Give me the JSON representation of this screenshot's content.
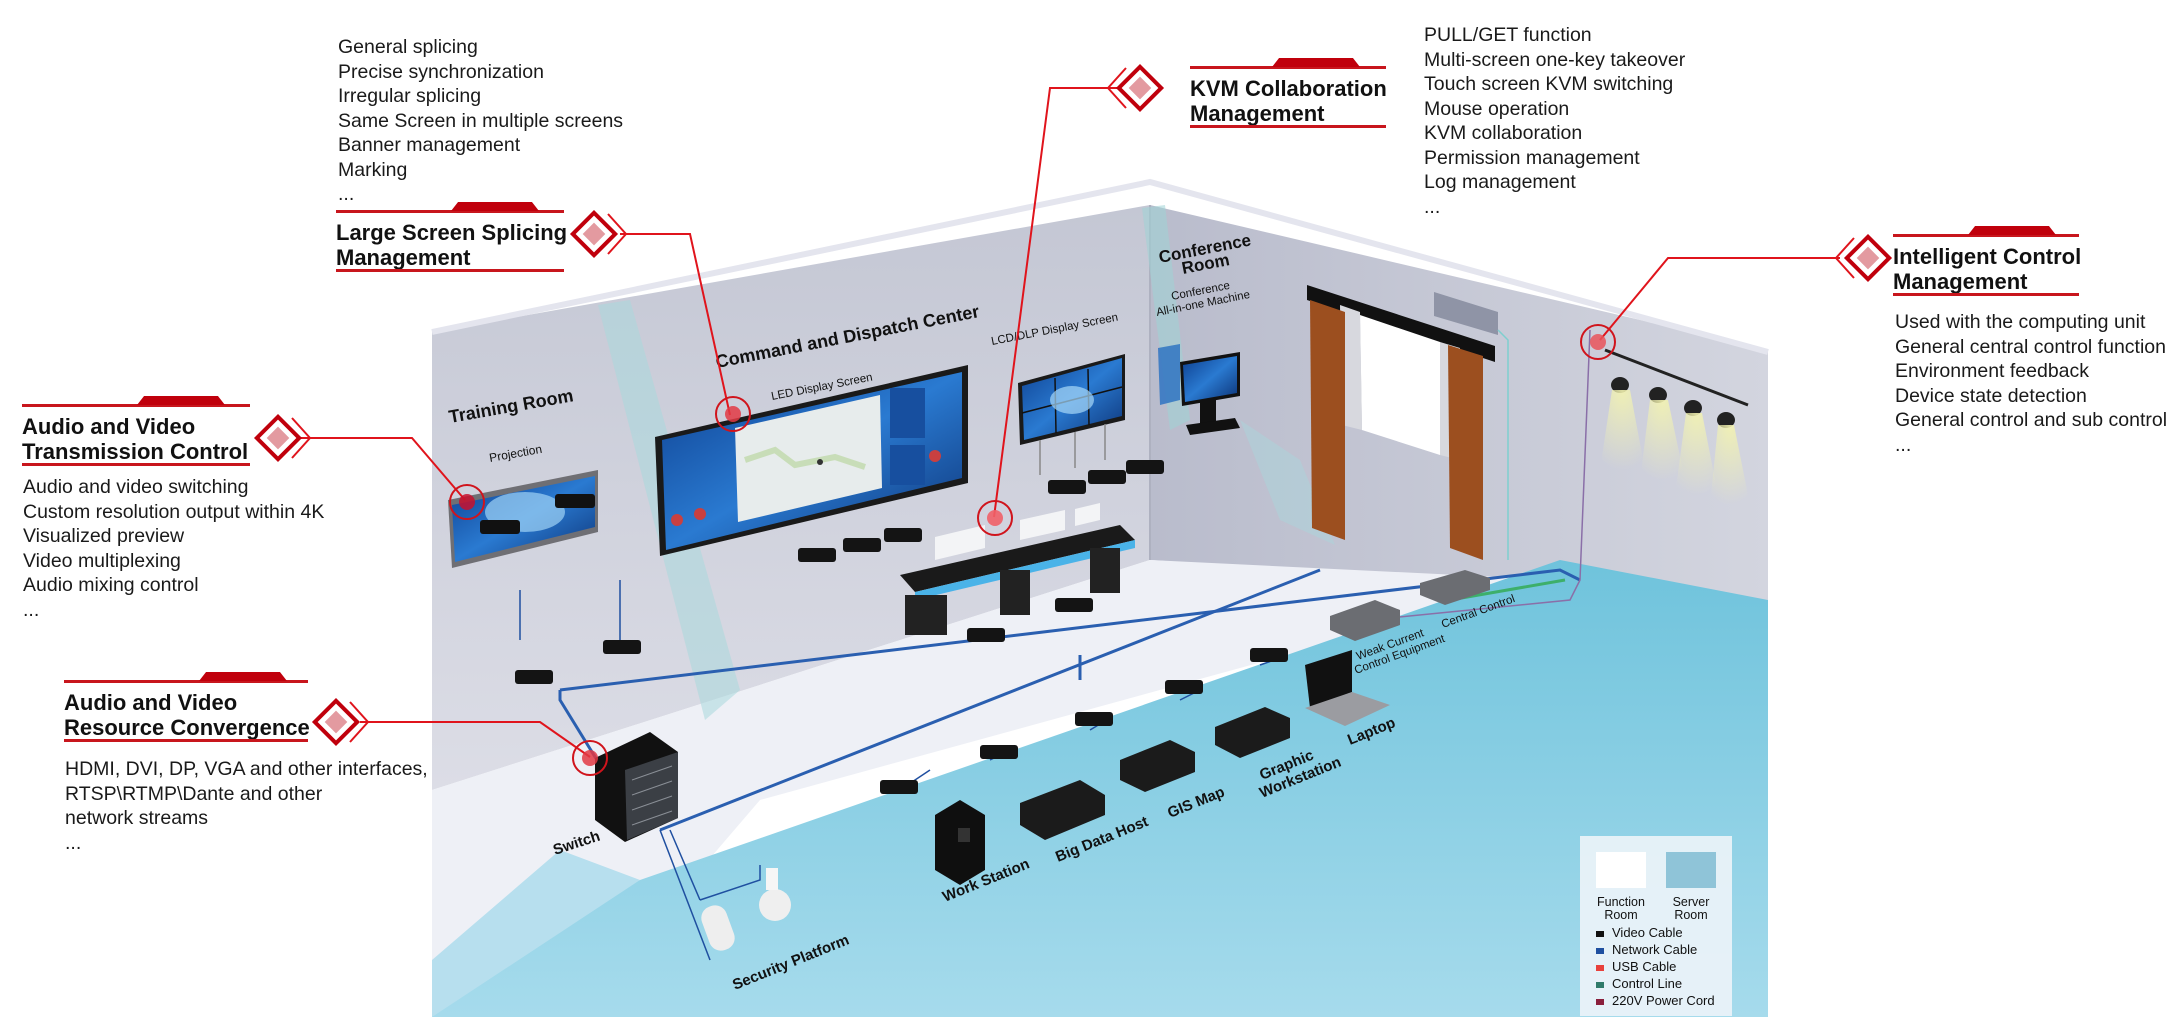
{
  "colors": {
    "accent_red": "#d71920",
    "dark_red": "#b3000b",
    "marker_fill": "#e8838a",
    "wall": "#c9ccd8",
    "floor_function": "#eef0f6",
    "floor_server": "#8ed0e6"
  },
  "modules": [
    {
      "id": "large-screen",
      "title": "Large Screen Splicing\nManagement",
      "title_lines": [
        "Large Screen Splicing",
        "Management"
      ],
      "features": [
        "General splicing",
        "Precise synchronization",
        "Irregular splicing",
        "Same Screen in multiple screens",
        "Banner management",
        "Marking",
        "..."
      ]
    },
    {
      "id": "kvm",
      "title_lines": [
        "KVM Collaboration",
        "Management"
      ],
      "features": [
        "PULL/GET function",
        "Multi-screen one-key takeover",
        "Touch screen KVM switching",
        "Mouse operation",
        "KVM collaboration",
        "Permission management",
        "Log management",
        "..."
      ]
    },
    {
      "id": "intelligent-control",
      "title_lines": [
        "Intelligent Control",
        "Management"
      ],
      "features": [
        "Used with the computing unit",
        "General central control function",
        "Environment feedback",
        "Device state detection",
        "General control and sub control",
        "..."
      ]
    },
    {
      "id": "av-transmission",
      "title_lines": [
        "Audio and Video",
        "Transmission Control"
      ],
      "features": [
        "Audio and video switching",
        "Custom resolution output within 4K",
        "Visualized preview",
        "Video multiplexing",
        "Audio mixing control",
        "..."
      ]
    },
    {
      "id": "av-resource",
      "title_lines": [
        "Audio and Video",
        "Resource Convergence"
      ],
      "features": [
        "HDMI, DVI, DP, VGA and other interfaces,",
        "RTSP\\RTMP\\Dante and other",
        "network streams",
        "..."
      ]
    }
  ],
  "scene": {
    "rooms": {
      "training": "Training Room",
      "projection": "Projection",
      "command": "Command and Dispatch Center",
      "led": "LED Display Screen",
      "lcd": "LCD/DLP Display Screen",
      "conference_1": "Conference",
      "conference_2": "Room",
      "conf_machine_1": "Conference",
      "conf_machine_2": "All-in-one Machine"
    },
    "devices": {
      "switch": "Switch",
      "security": "Security Platform",
      "workstation": "Work Station",
      "bigdata": "Big Data Host",
      "gis": "GIS Map",
      "graphic_1": "Graphic",
      "graphic_2": "Workstation",
      "laptop": "Laptop",
      "weak_1": "Weak Current",
      "weak_2": "Control Equipment",
      "central": "Central Control"
    }
  },
  "legend": {
    "rooms": [
      {
        "label_1": "Function",
        "label_2": "Room",
        "color": "#ffffff"
      },
      {
        "label_1": "Server",
        "label_2": "Room",
        "color": "#8fc4d8"
      }
    ],
    "cables": [
      {
        "label": "Video Cable",
        "color": "#111111"
      },
      {
        "label": "Network Cable",
        "color": "#1f4fa0"
      },
      {
        "label": "USB Cable",
        "color": "#e8413c"
      },
      {
        "label": "Control Line",
        "color": "#2f7a6a"
      },
      {
        "label": "220V Power Cord",
        "color": "#8a1f3c"
      }
    ]
  }
}
